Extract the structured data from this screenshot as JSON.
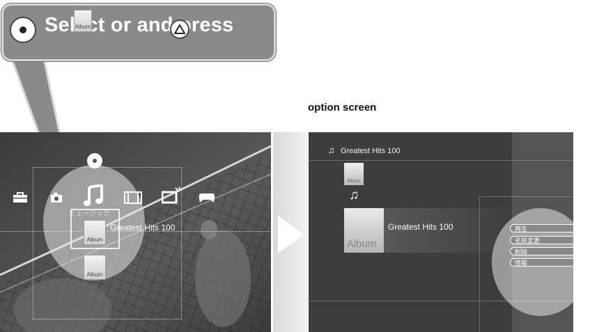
{
  "callout": {
    "text": "Select or and press",
    "circle_button_icon": "circle-button-icon",
    "triangle_button_icon": "triangle-button-icon",
    "album_icon_label": "Album"
  },
  "option_screen_label": "option screen",
  "xmb": {
    "categories": [
      {
        "icon": "toolbox-icon",
        "glyph": "🧰"
      },
      {
        "icon": "camera-icon",
        "glyph": "📷"
      },
      {
        "icon": "music-note-icon",
        "glyph": "♫"
      },
      {
        "icon": "film-icon",
        "glyph": "🎞"
      },
      {
        "icon": "tv-icon",
        "glyph": "📺"
      },
      {
        "icon": "gamepad-icon",
        "glyph": "🎮"
      }
    ],
    "disc_icon": "disc-icon",
    "category_label": "ミュージック",
    "selected_title": "Greatest Hits 100",
    "album_label": "Album"
  },
  "option": {
    "path": "Greatest Hits 100",
    "album_label": "Album",
    "title": "Greatest Hits 100",
    "menu": [
      "再生",
      "名前変更",
      "削除",
      "情報"
    ]
  }
}
